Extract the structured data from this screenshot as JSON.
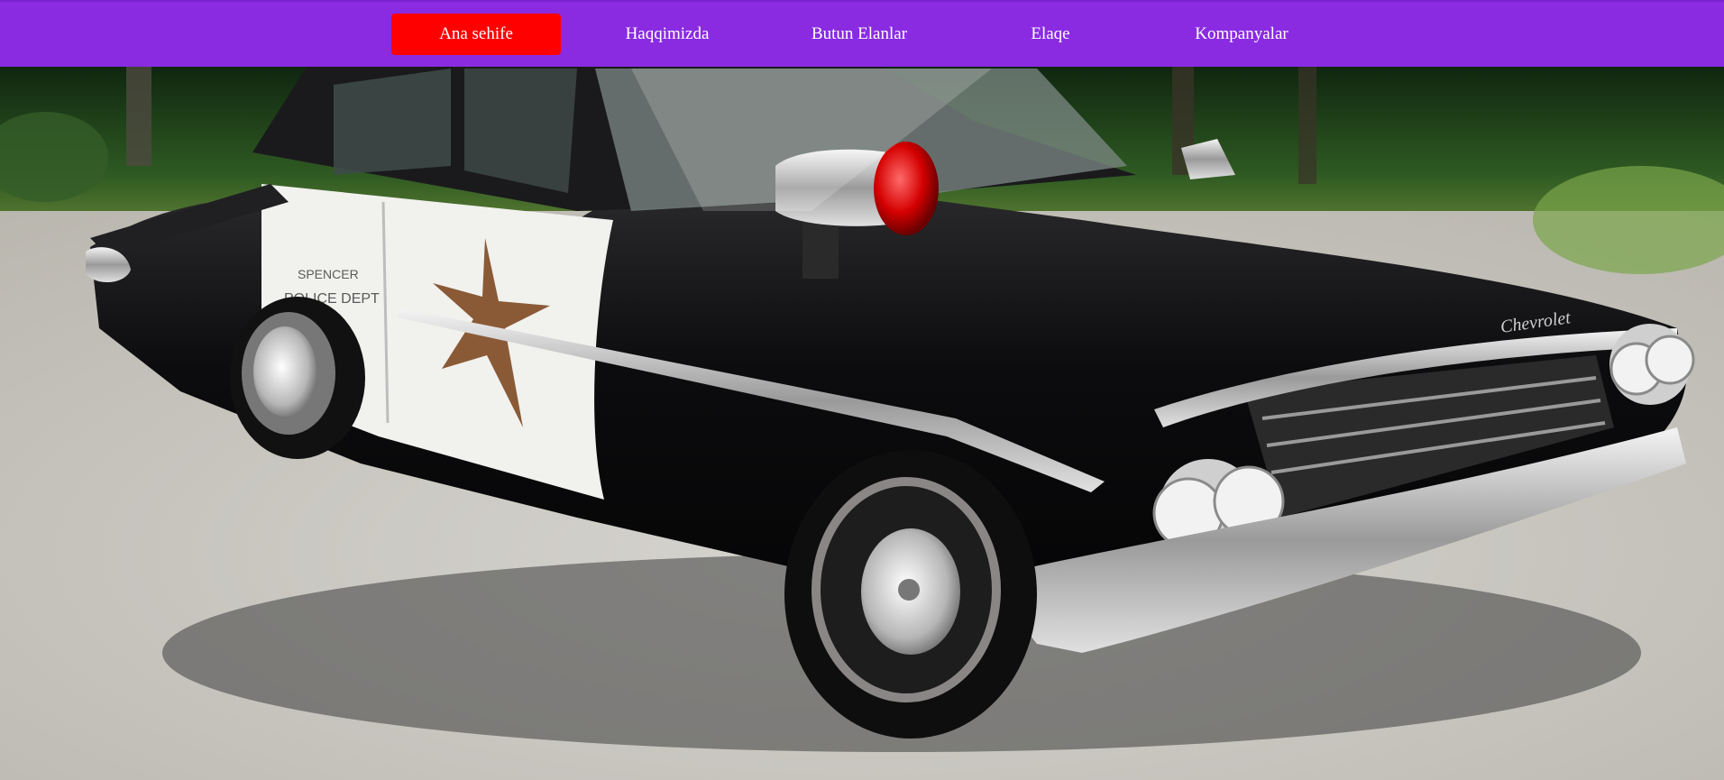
{
  "nav": {
    "items": [
      {
        "label": "Ana sehife",
        "active": true
      },
      {
        "label": "Haqqimizda",
        "active": false
      },
      {
        "label": "Butun Elanlar",
        "active": false
      },
      {
        "label": "Elaqe",
        "active": false
      },
      {
        "label": "Kompanyalar",
        "active": false
      }
    ]
  },
  "hero": {
    "image_subject": "vintage black-and-white police car",
    "door_text_line1": "SPENCER",
    "door_text_line2": "POLICE DEPT",
    "badge_script": "Chevrolet"
  },
  "colors": {
    "header_bg": "#8a2be2",
    "active_nav_bg": "#ff0000",
    "nav_text": "#ffffff"
  }
}
